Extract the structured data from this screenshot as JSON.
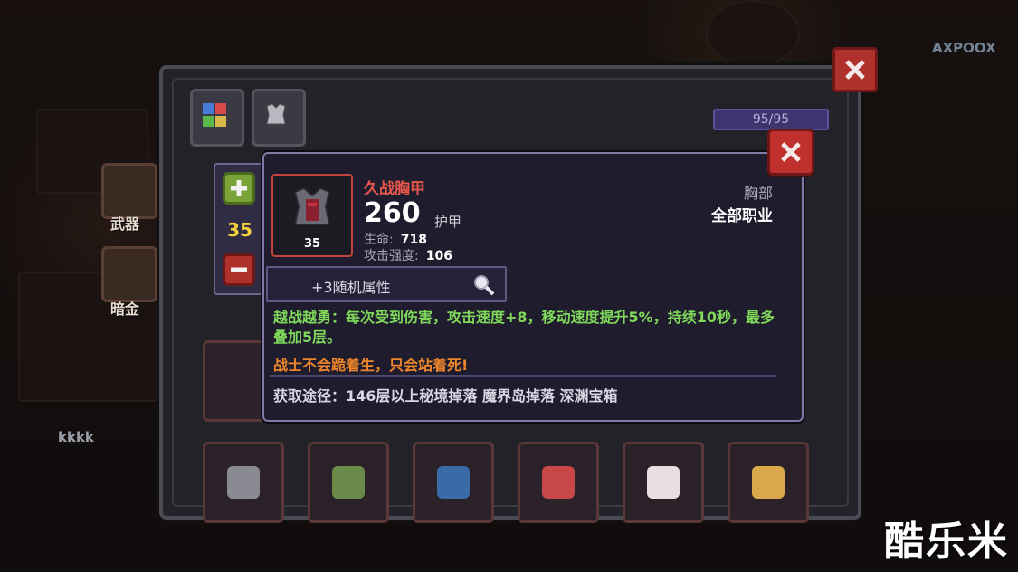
{
  "background": {
    "side_slots": [
      {
        "label": "武器"
      },
      {
        "label": "暗金"
      }
    ],
    "player_name": "kkkk",
    "watermark_top": "AXPOOX"
  },
  "watermark": "酷乐米",
  "inventory": {
    "tabs": [
      {
        "icon": "inventory-grid-icon"
      },
      {
        "icon": "armor-tab-icon"
      }
    ],
    "capacity": "95/95",
    "items": [
      {
        "icon": "armor-dark-icon",
        "color": "#8a8a92"
      },
      {
        "icon": "armor-green-icon",
        "color": "#6a8a4a"
      },
      {
        "icon": "armor-blue-icon",
        "color": "#3a6aa8"
      },
      {
        "icon": "armor-red-hood-icon",
        "color": "#c8484a"
      },
      {
        "icon": "armor-white-red-icon",
        "color": "#e8e0e0"
      },
      {
        "icon": "armor-gold-icon",
        "color": "#d8a84a"
      }
    ]
  },
  "level_control": {
    "value": "35"
  },
  "tooltip": {
    "name": "久战胸甲",
    "name_color": "#e8574c",
    "armor_value": "260",
    "armor_label": "护甲",
    "icon_level": "35",
    "stats": [
      {
        "label": "生命:",
        "value": "718"
      },
      {
        "label": "攻击强度:",
        "value": "106"
      }
    ],
    "slot": "胸部",
    "class": "全部职业",
    "random_attr": "+3随机属性",
    "effect_text": "越战越勇：每次受到伤害，攻击速度+8，移动速度提升5%，持续10秒，最多叠加5层。",
    "quote": "战士不会跪着生，只会站着死!",
    "source": "获取途径：146层以上秘境掉落 魔界岛掉落 深渊宝箱"
  }
}
